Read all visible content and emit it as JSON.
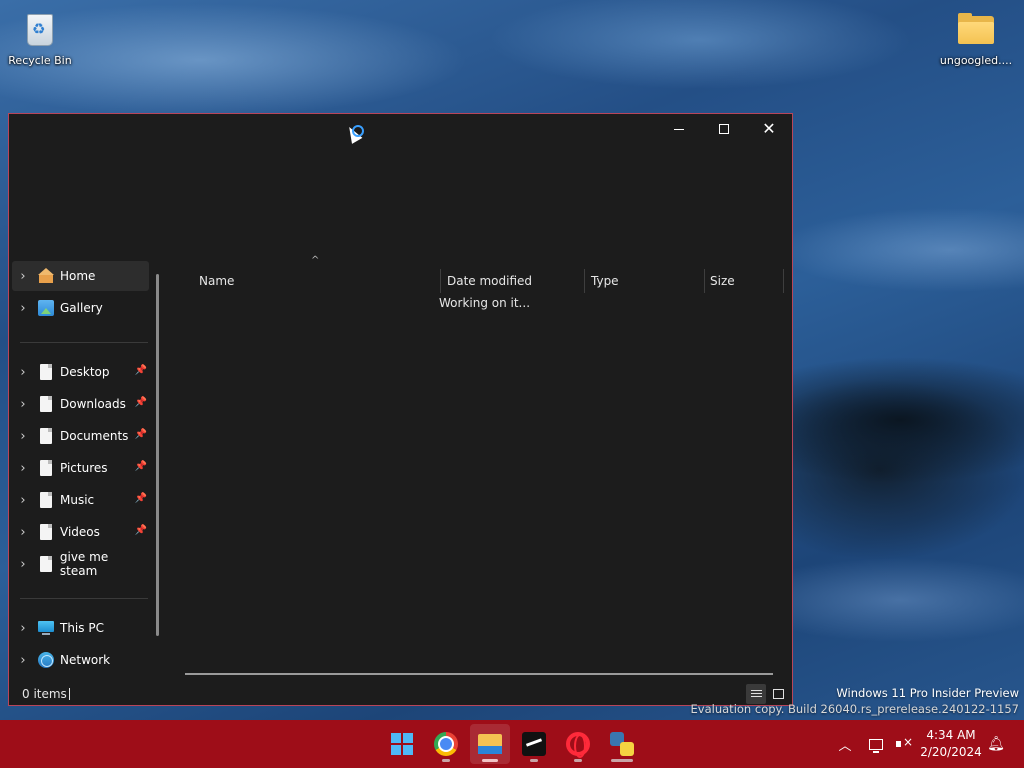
{
  "desktop": {
    "icons": [
      {
        "label": "Recycle Bin",
        "icon": "recycle-bin-icon"
      },
      {
        "label": "ungoogled....",
        "icon": "folder-icon"
      }
    ]
  },
  "window": {
    "controls": {
      "minimize": "minimize-icon",
      "maximize": "maximize-icon",
      "close": "close-icon"
    },
    "navigation": {
      "items": [
        {
          "label": "Home",
          "icon": "home-icon",
          "pinned": false,
          "selected": true
        },
        {
          "label": "Gallery",
          "icon": "gallery-icon",
          "pinned": false
        },
        {
          "label": "Desktop",
          "icon": "document-icon",
          "pinned": true
        },
        {
          "label": "Downloads",
          "icon": "document-icon",
          "pinned": true
        },
        {
          "label": "Documents",
          "icon": "document-icon",
          "pinned": true
        },
        {
          "label": "Pictures",
          "icon": "document-icon",
          "pinned": true
        },
        {
          "label": "Music",
          "icon": "document-icon",
          "pinned": true
        },
        {
          "label": "Videos",
          "icon": "document-icon",
          "pinned": true
        },
        {
          "label": "give me steam",
          "icon": "document-icon",
          "pinned": false
        },
        {
          "label": "This PC",
          "icon": "computer-icon",
          "pinned": false
        },
        {
          "label": "Network",
          "icon": "network-icon",
          "pinned": false
        }
      ]
    },
    "columns": [
      "Name",
      "Date modified",
      "Type",
      "Size"
    ],
    "status_message": "Working on it...",
    "status_bar": {
      "item_count": "0 items"
    }
  },
  "watermark": {
    "line1": "Windows 11 Pro Insider Preview",
    "line2": "Evaluation copy. Build 26040.rs_prerelease.240122-1157"
  },
  "taskbar": {
    "apps": [
      {
        "name": "start",
        "icon": "windows-start-icon"
      },
      {
        "name": "chrome",
        "icon": "chrome-icon"
      },
      {
        "name": "file-explorer",
        "icon": "file-explorer-icon"
      },
      {
        "name": "steam",
        "icon": "steam-icon"
      },
      {
        "name": "opera",
        "icon": "opera-icon"
      },
      {
        "name": "python",
        "icon": "python-icon"
      }
    ],
    "time": "4:34 AM",
    "date": "2/20/2024"
  },
  "colors": {
    "taskbar": "#9e0d18",
    "window_border": "#b8455a",
    "window_bg": "#1c1c1c",
    "accent": "#4fb8f6"
  }
}
